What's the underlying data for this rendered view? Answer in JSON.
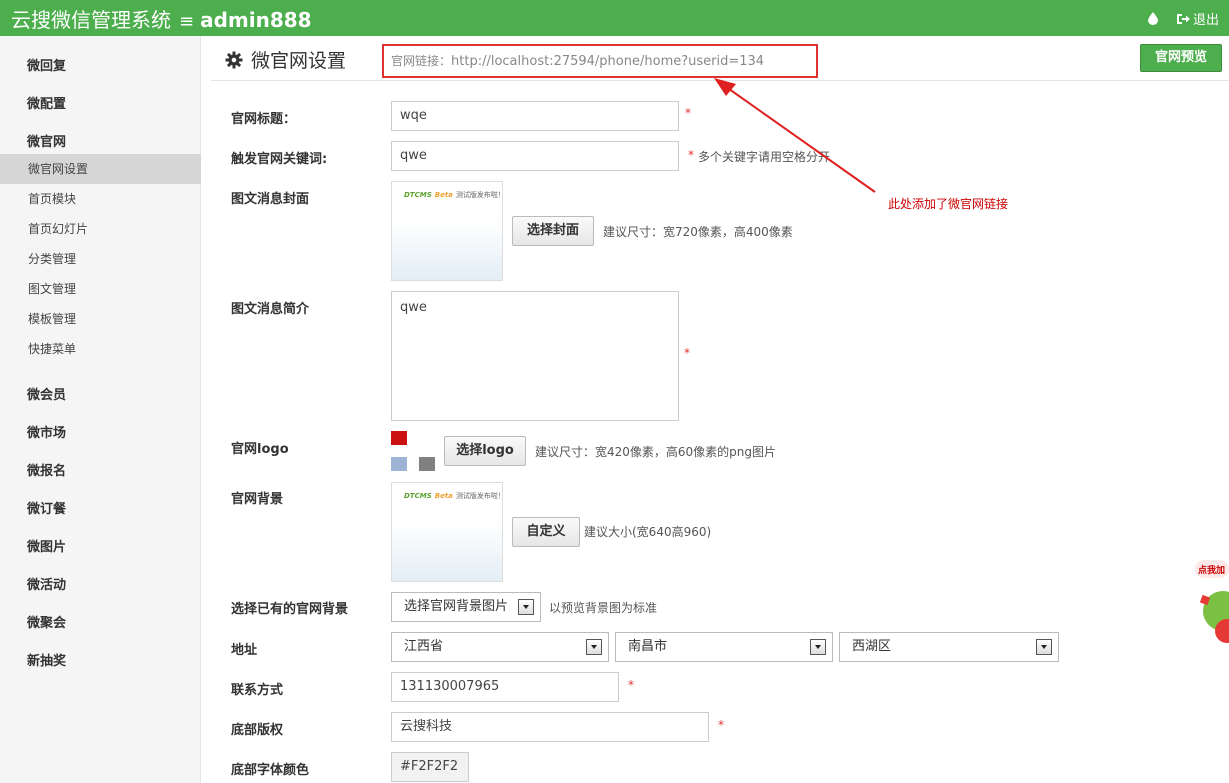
{
  "header": {
    "app_title": "云搜微信管理系统",
    "menu_glyph": "≡",
    "username": "admin888",
    "logout_label": "退出"
  },
  "sidebar": {
    "groups": [
      {
        "label": "微回复"
      },
      {
        "label": "微配置"
      },
      {
        "label": "微官网"
      }
    ],
    "subitems": [
      {
        "label": "微官网设置",
        "active": true
      },
      {
        "label": "首页模块"
      },
      {
        "label": "首页幻灯片"
      },
      {
        "label": "分类管理"
      },
      {
        "label": "图文管理"
      },
      {
        "label": "模板管理"
      },
      {
        "label": "快捷菜单"
      }
    ],
    "groups_after": [
      {
        "label": "微会员"
      },
      {
        "label": "微市场"
      },
      {
        "label": "微报名"
      },
      {
        "label": "微订餐"
      },
      {
        "label": "微图片"
      },
      {
        "label": "微活动"
      },
      {
        "label": "微聚会"
      },
      {
        "label": "新抽奖"
      }
    ]
  },
  "page": {
    "title": "微官网设置",
    "url_label": "官网链接：",
    "url_value": "http://localhost:27594/phone/home?userid=134",
    "preview_button": "官网预览"
  },
  "form": {
    "site_title": {
      "label": "官网标题：",
      "value": "wqe"
    },
    "keywords": {
      "label": "触发官网关键词:",
      "value": "qwe",
      "hint": "多个关键字请用空格分开"
    },
    "cover": {
      "label": "图文消息封面",
      "button": "选择封面",
      "hint": "建议尺寸：宽720像素，高400像素"
    },
    "intro": {
      "label": "图文消息简介",
      "value": "qwe"
    },
    "logo": {
      "label": "官网logo",
      "button": "选择logo",
      "hint": "建议尺寸：宽420像素，高60像素的png图片"
    },
    "background": {
      "label": "官网背景",
      "button": "自定义",
      "hint": "建议大小(宽640高960)"
    },
    "existing_bg": {
      "label": "选择已有的官网背景",
      "select_value": "选择官网背景图片",
      "hint": "以预览背景图为标准"
    },
    "address": {
      "label": "地址",
      "province": "江西省",
      "city": "南昌市",
      "district": "西湖区"
    },
    "contact": {
      "label": "联系方式",
      "value": "131130007965"
    },
    "footer": {
      "label": "底部版权",
      "value": "云搜科技"
    },
    "footer_color": {
      "label": "底部字体颜色",
      "value": "#F2F2F2"
    }
  },
  "thumbnail": {
    "logo_text": "DTCMS",
    "beta_text": "Beta",
    "tagline": "测试版发布啦！"
  },
  "annotation": {
    "text": "此处添加了微官网链接",
    "color": "#cc0000"
  },
  "float_widget": {
    "text": "点我加"
  },
  "colors": {
    "brand_green": "#4cae4c",
    "required_red": "#e03232",
    "swatch_red": "#cc1111",
    "swatch_blue": "#9db3d4",
    "swatch_gray": "#808080"
  },
  "required_mark": "*"
}
